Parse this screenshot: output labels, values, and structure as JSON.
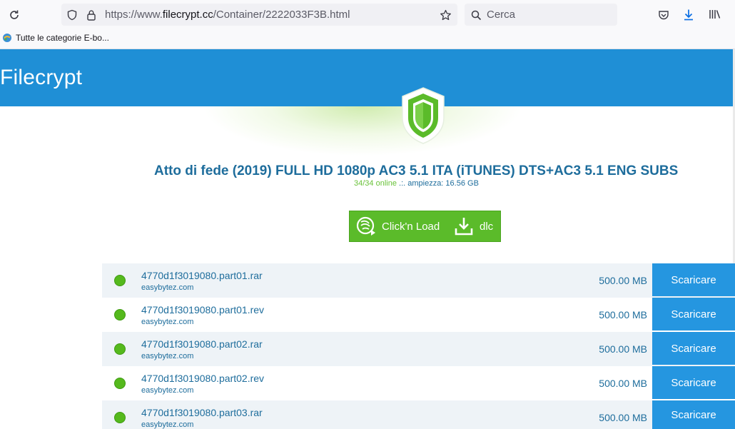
{
  "browser": {
    "url_scheme": "https://www.",
    "url_host": "filecrypt.cc",
    "url_path": "/Container/2222033F3B.html",
    "search_placeholder": "Cerca",
    "bookmark_label": "Tutte le categorie E-bo..."
  },
  "site": {
    "brand": "Filecrypt",
    "header_color": "#1f8fd6"
  },
  "container": {
    "title": "Atto di fede (2019) FULL HD 1080p AC3 5.1 ITA (iTUNES) DTS+AC3 5.1 ENG SUBS",
    "online_status": "34/34 online",
    "separator": " .:. ",
    "size_text": "ampiezza: 16.56 GB",
    "cnl_label": "Click'n Load",
    "dlc_label": "dlc"
  },
  "files": [
    {
      "name": "4770d1f3019080.part01.rar",
      "host": "easybytez.com",
      "size": "500.00 MB",
      "button": "Scaricare"
    },
    {
      "name": "4770d1f3019080.part01.rev",
      "host": "easybytez.com",
      "size": "500.00 MB",
      "button": "Scaricare"
    },
    {
      "name": "4770d1f3019080.part02.rar",
      "host": "easybytez.com",
      "size": "500.00 MB",
      "button": "Scaricare"
    },
    {
      "name": "4770d1f3019080.part02.rev",
      "host": "easybytez.com",
      "size": "500.00 MB",
      "button": "Scaricare"
    },
    {
      "name": "4770d1f3019080.part03.rar",
      "host": "easybytez.com",
      "size": "500.00 MB",
      "button": "Scaricare"
    }
  ]
}
